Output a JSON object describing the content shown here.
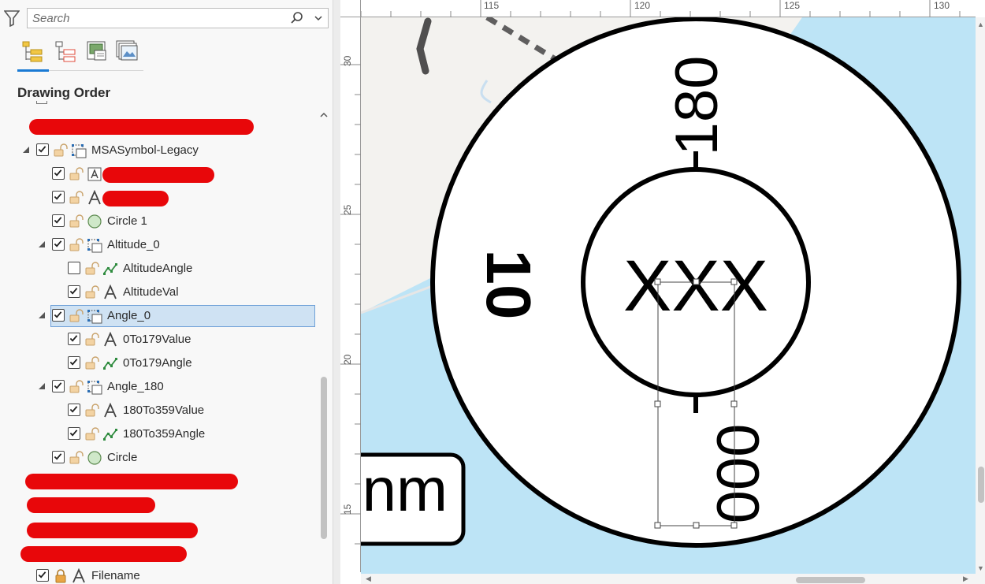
{
  "search": {
    "placeholder": "Search"
  },
  "contents": {
    "title": "Drawing Order"
  },
  "tree": [
    {
      "label": "MSASymbol-Legacy",
      "checked": true,
      "icon": "group-element-icon"
    },
    {
      "label": "",
      "checked": true,
      "icon": "text-box-icon",
      "redacted": true
    },
    {
      "label": "",
      "checked": true,
      "icon": "text-icon",
      "redacted": true
    },
    {
      "label": "Circle 1",
      "checked": true,
      "icon": "circle-icon"
    },
    {
      "label": "Altitude_0",
      "checked": true,
      "icon": "group-element-icon"
    },
    {
      "label": "AltitudeAngle",
      "checked": false,
      "icon": "line-icon"
    },
    {
      "label": "AltitudeVal",
      "checked": true,
      "icon": "text-icon"
    },
    {
      "label": "Angle_0",
      "checked": true,
      "icon": "group-element-icon",
      "selected": true
    },
    {
      "label": "0To179Value",
      "checked": true,
      "icon": "text-icon"
    },
    {
      "label": "0To179Angle",
      "checked": true,
      "icon": "line-icon"
    },
    {
      "label": "Angle_180",
      "checked": true,
      "icon": "group-element-icon"
    },
    {
      "label": "180To359Value",
      "checked": true,
      "icon": "text-icon"
    },
    {
      "label": "180To359Angle",
      "checked": true,
      "icon": "line-icon"
    },
    {
      "label": "Circle",
      "checked": true,
      "icon": "circle-icon"
    },
    {
      "label": "Filename",
      "checked": true,
      "icon": "text-icon"
    }
  ],
  "rulers": {
    "top": [
      "115",
      "120",
      "125",
      "130"
    ],
    "left": [
      "30",
      "25",
      "20",
      "15"
    ]
  },
  "map": {
    "text_180": "180",
    "text_000": "000",
    "text_10": "10",
    "text_center": "XXX",
    "text_box": "nm"
  },
  "colors": {
    "selection": "#cfe2f3",
    "selection_border": "#6fa0d8",
    "redaction": "#e8070a",
    "water": "#bde4f6",
    "accent": "#1a7ad4"
  }
}
